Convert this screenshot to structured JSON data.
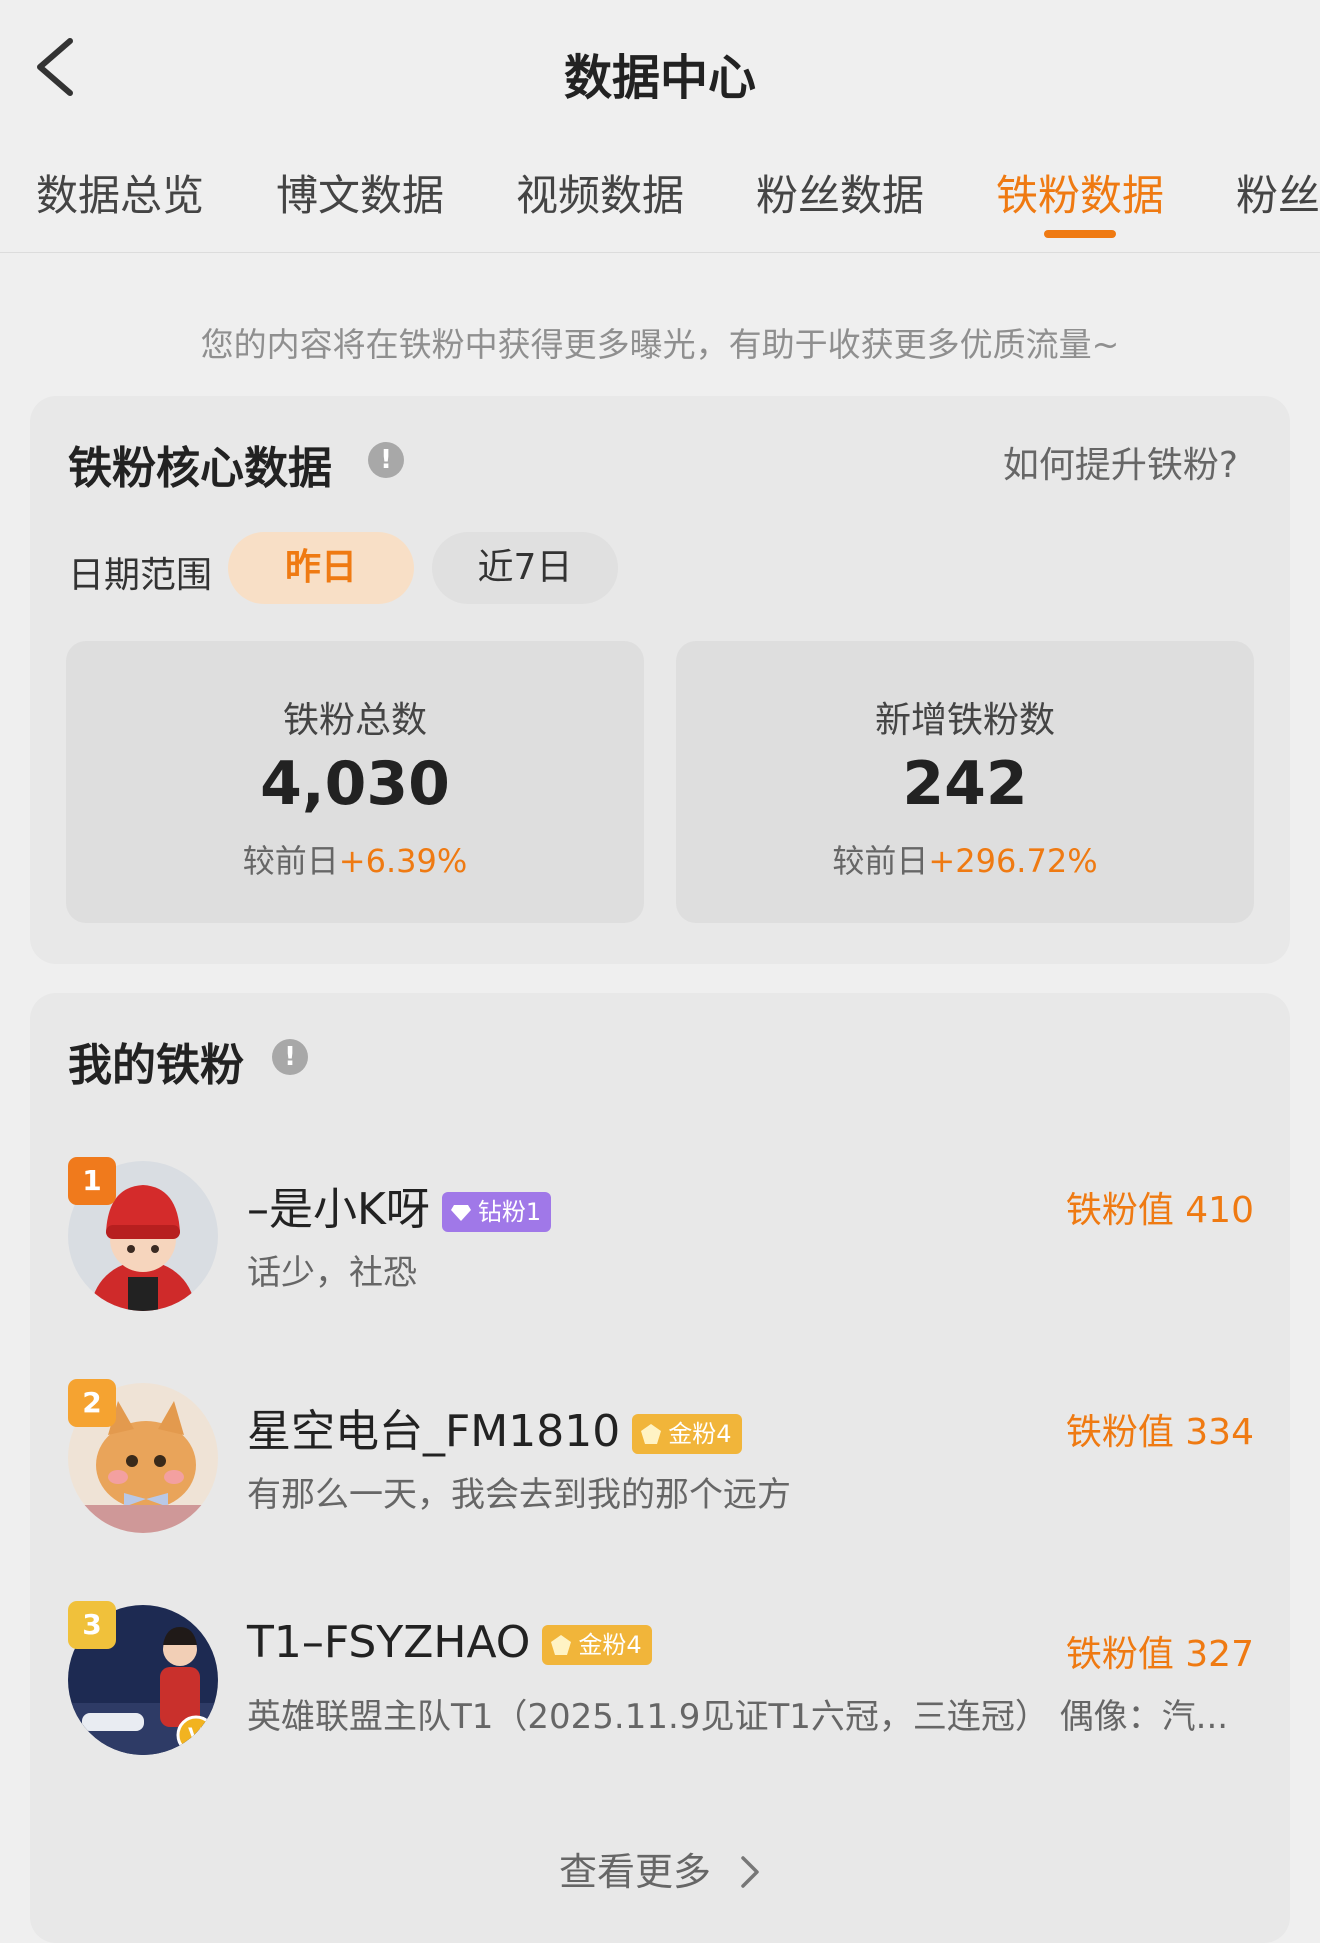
{
  "header": {
    "title": "数据中心",
    "back_icon": "chevron-left-icon"
  },
  "tabs": [
    {
      "label": "数据总览",
      "active": false
    },
    {
      "label": "博文数据",
      "active": false
    },
    {
      "label": "视频数据",
      "active": false
    },
    {
      "label": "粉丝数据",
      "active": false
    },
    {
      "label": "铁粉数据",
      "active": true
    },
    {
      "label": "粉丝",
      "active": false
    }
  ],
  "tip": "您的内容将在铁粉中获得更多曝光，有助于收获更多优质流量~",
  "core": {
    "title": "铁粉核心数据",
    "help_link": "如何提升铁粉?",
    "range_label": "日期范围",
    "ranges": [
      "昨日",
      "近7日"
    ],
    "selected_range": "昨日",
    "stats": [
      {
        "label": "铁粉总数",
        "value": "4,030",
        "compare_label": "较前日",
        "compare_value": "+6.39%"
      },
      {
        "label": "新增铁粉数",
        "value": "242",
        "compare_label": "较前日",
        "compare_value": "+296.72%"
      }
    ]
  },
  "fans": {
    "title": "我的铁粉",
    "list": [
      {
        "rank": "1",
        "name": "–是小K呀",
        "badge": "钻粉1",
        "badge_type": "diamond",
        "bio": "话少，社恐",
        "score": "铁粉值 410"
      },
      {
        "rank": "2",
        "name": "星空电台_FM1810",
        "badge": "金粉4",
        "badge_type": "gold",
        "bio": "有那么一天，我会去到我的那个远方",
        "score": "铁粉值 334"
      },
      {
        "rank": "3",
        "name": "T1–FSYZHAO",
        "badge": "金粉4",
        "badge_type": "gold",
        "bio": "英雄联盟主队T1（2025.11.9见证T1六冠，三连冠） 偶像：汽...",
        "score": "铁粉值 327",
        "verified_mark": "V"
      }
    ],
    "see_more": "查看更多"
  },
  "colors": {
    "accent": "#ef7a12",
    "background": "#efefef",
    "card": "#e8e8e8",
    "diamond_badge": "#a078e8",
    "gold_badge": "#f1b53a"
  }
}
